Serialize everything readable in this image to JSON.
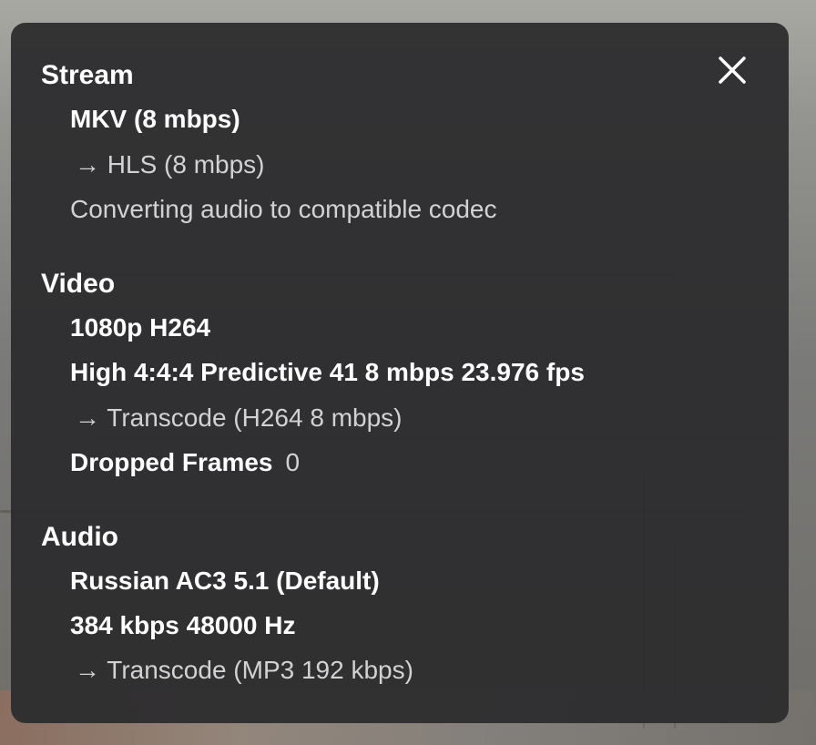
{
  "panel": {
    "close_icon": "close-icon"
  },
  "stream": {
    "title": "Stream",
    "container": "MKV (8 mbps)",
    "output": "→ HLS (8 mbps)",
    "note": "Converting audio to compatible codec"
  },
  "video": {
    "title": "Video",
    "format": "1080p H264",
    "profile": "High 4:4:4 Predictive 41 8 mbps 23.976 fps",
    "output": "→ Transcode (H264 8 mbps)",
    "dropped_frames_label": "Dropped Frames",
    "dropped_frames_value": "0"
  },
  "audio": {
    "title": "Audio",
    "track": "Russian AC3 5.1 (Default)",
    "details": "384 kbps 48000 Hz",
    "output": "→ Transcode (MP3 192 kbps)"
  }
}
